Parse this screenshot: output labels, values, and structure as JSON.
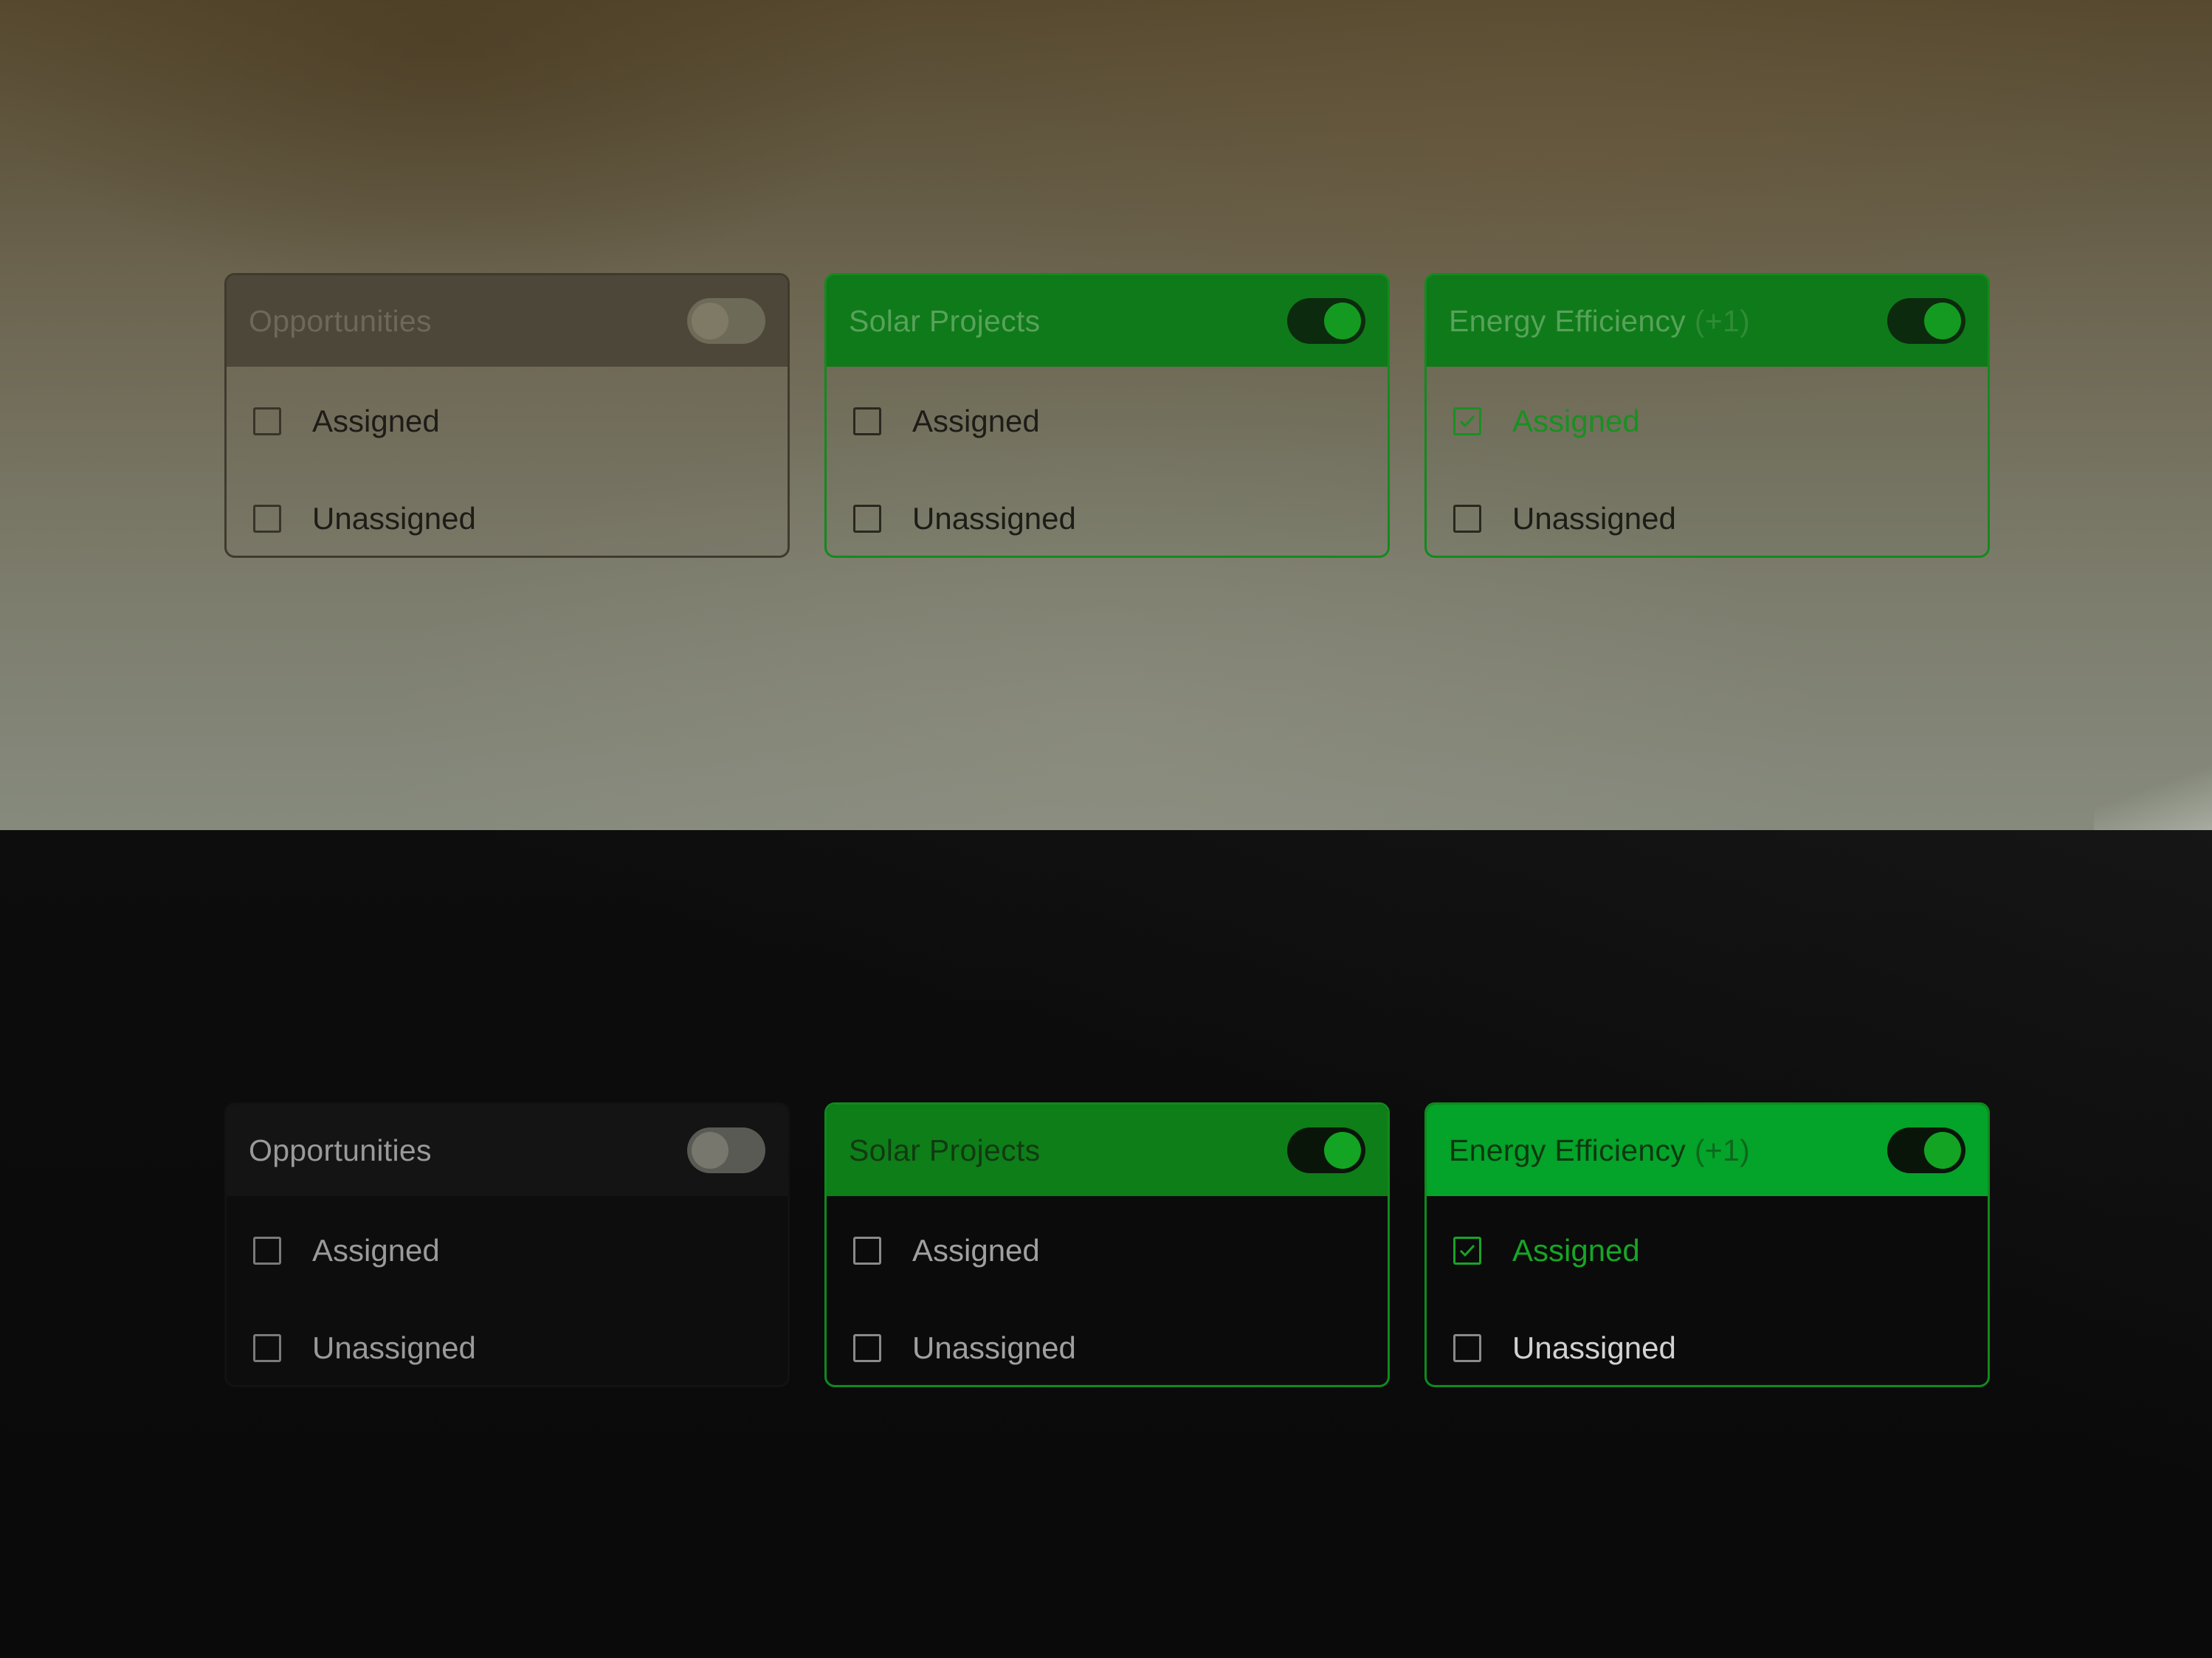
{
  "themes": {
    "light": {
      "cards": [
        {
          "title": "Opportunities",
          "count": "",
          "toggle_on": false,
          "rows": [
            {
              "label": "Assigned",
              "checked": false
            },
            {
              "label": "Unassigned",
              "checked": false
            }
          ]
        },
        {
          "title": "Solar Projects",
          "count": "",
          "toggle_on": true,
          "rows": [
            {
              "label": "Assigned",
              "checked": false
            },
            {
              "label": "Unassigned",
              "checked": false
            }
          ]
        },
        {
          "title": "Energy Efficiency",
          "count": "(+1)",
          "toggle_on": true,
          "rows": [
            {
              "label": "Assigned",
              "checked": true
            },
            {
              "label": "Unassigned",
              "checked": false
            }
          ]
        }
      ]
    },
    "dark": {
      "cards": [
        {
          "title": "Opportunities",
          "count": "",
          "toggle_on": false,
          "rows": [
            {
              "label": "Assigned",
              "checked": false
            },
            {
              "label": "Unassigned",
              "checked": false
            }
          ]
        },
        {
          "title": "Solar Projects",
          "count": "",
          "toggle_on": true,
          "rows": [
            {
              "label": "Assigned",
              "checked": false
            },
            {
              "label": "Unassigned",
              "checked": false
            }
          ]
        },
        {
          "title": "Energy Efficiency",
          "count": "(+1)",
          "toggle_on": true,
          "rows": [
            {
              "label": "Assigned",
              "checked": true
            },
            {
              "label": "Unassigned",
              "checked": false
            }
          ]
        }
      ]
    }
  },
  "colors": {
    "accent_green": "#13A424",
    "light_card_header_green": "#0F7A19",
    "dark_card_header_green": "#04A32A",
    "dark_background": "#0B0B0B"
  },
  "icons": {
    "check": "check-icon"
  }
}
